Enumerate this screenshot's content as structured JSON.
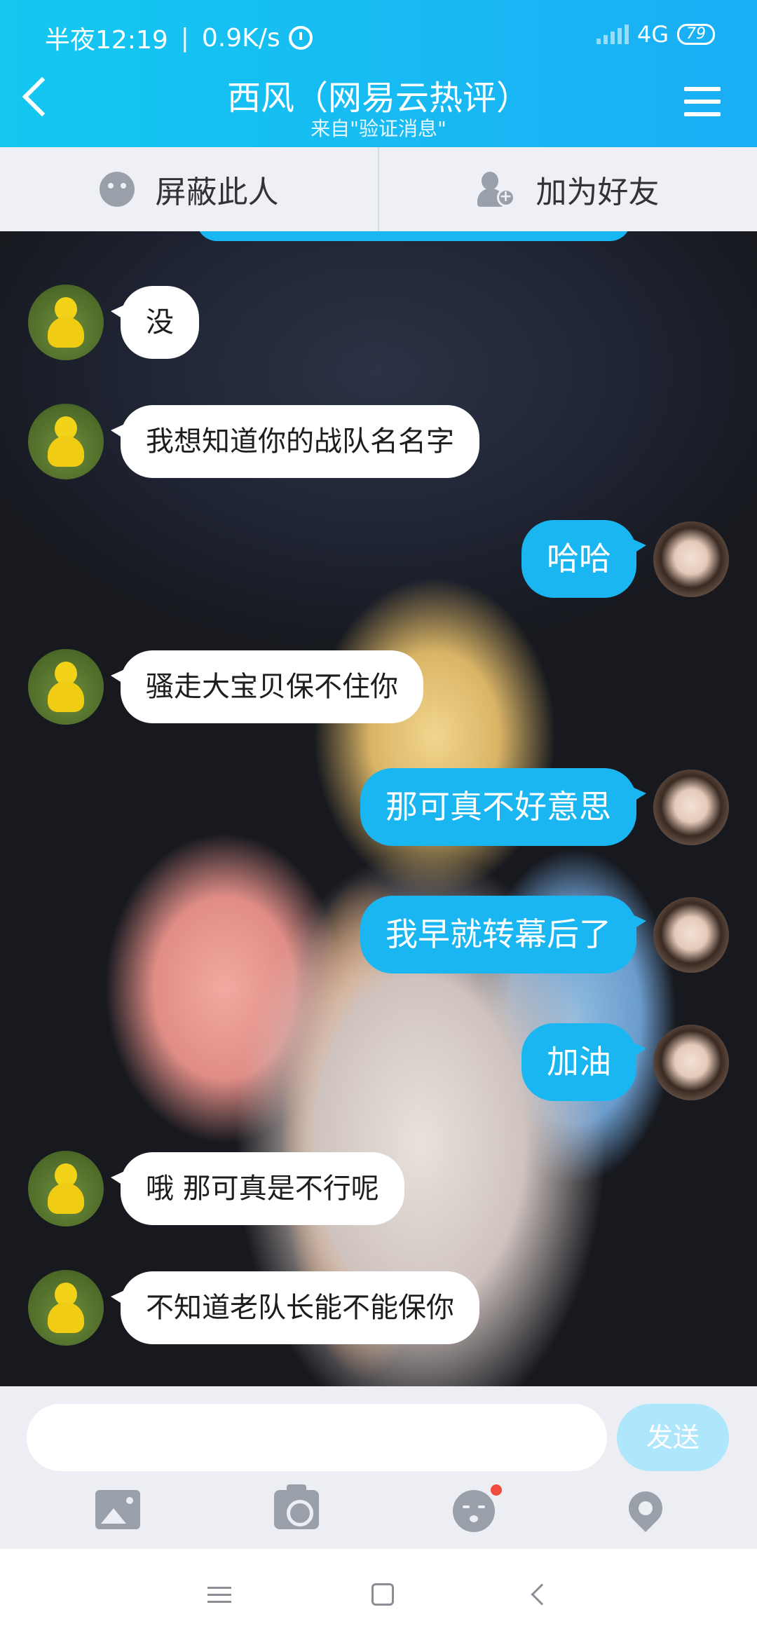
{
  "status_bar": {
    "time": "半夜12:19",
    "network_speed": "0.9K/s",
    "network_type": "4G",
    "battery": "79"
  },
  "header": {
    "title": "西风（网易云热评）",
    "subtitle": "来自\"验证消息\""
  },
  "actions": {
    "block_label": "屏蔽此人",
    "add_friend_label": "加为好友"
  },
  "messages": [
    {
      "side": "left",
      "text": "没"
    },
    {
      "side": "left",
      "text": "我想知道你的战队名名字"
    },
    {
      "side": "right",
      "text": "哈哈"
    },
    {
      "side": "left",
      "text": "骚走大宝贝保不住你"
    },
    {
      "side": "right",
      "text": "那可真不好意思"
    },
    {
      "side": "right",
      "text": "我早就转幕后了"
    },
    {
      "side": "right",
      "text": "加油"
    },
    {
      "side": "left",
      "text": "哦 那可真是不行呢"
    },
    {
      "side": "left",
      "text": "不知道老队长能不能保你"
    }
  ],
  "composer": {
    "input_value": "",
    "send_label": "发送"
  },
  "tools": [
    "image-icon",
    "camera-icon",
    "emoji-icon",
    "location-icon"
  ],
  "colors": {
    "accent": "#1ab6f2",
    "header": "#14c8f0",
    "notification_dot": "#f04b3c"
  }
}
